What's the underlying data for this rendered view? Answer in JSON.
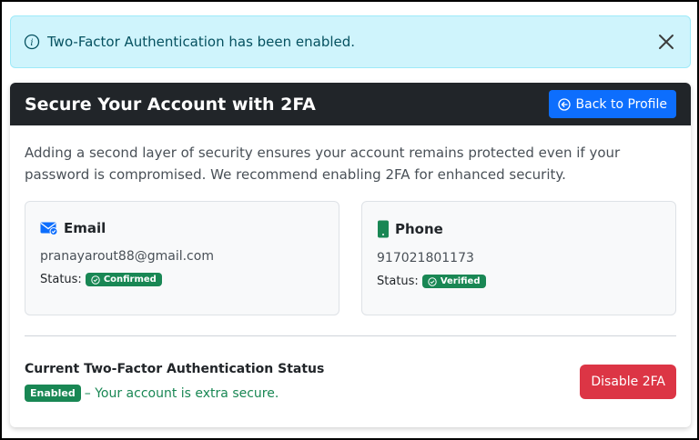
{
  "alert": {
    "message": "Two-Factor Authentication has been enabled.",
    "icon": "info-circle-icon",
    "close_icon": "close-icon",
    "color_bg": "#cff4fc",
    "color_text": "#055160"
  },
  "card": {
    "title": "Secure Your Account with 2FA",
    "back_label": "Back to Profile",
    "intro": "Adding a second layer of security ensures your account remains protected even if your password is compromised. We recommend enabling 2FA for enhanced security.",
    "methods": [
      {
        "title": "Email",
        "icon": "email-check-icon",
        "value": "pranayarout88@gmail.com",
        "status_label": "Status:",
        "badge": "Confirmed"
      },
      {
        "title": "Phone",
        "icon": "phone-icon",
        "value": "917021801173",
        "status_label": "Status:",
        "badge": "Verified"
      }
    ],
    "status_heading": "Current Two-Factor Authentication Status",
    "status_badge": "Enabled",
    "status_text": "– Your account is extra secure.",
    "disable_label": "Disable 2FA"
  },
  "colors": {
    "header_bg": "#212529",
    "primary": "#0d6efd",
    "success": "#198754",
    "danger": "#dc3545"
  }
}
